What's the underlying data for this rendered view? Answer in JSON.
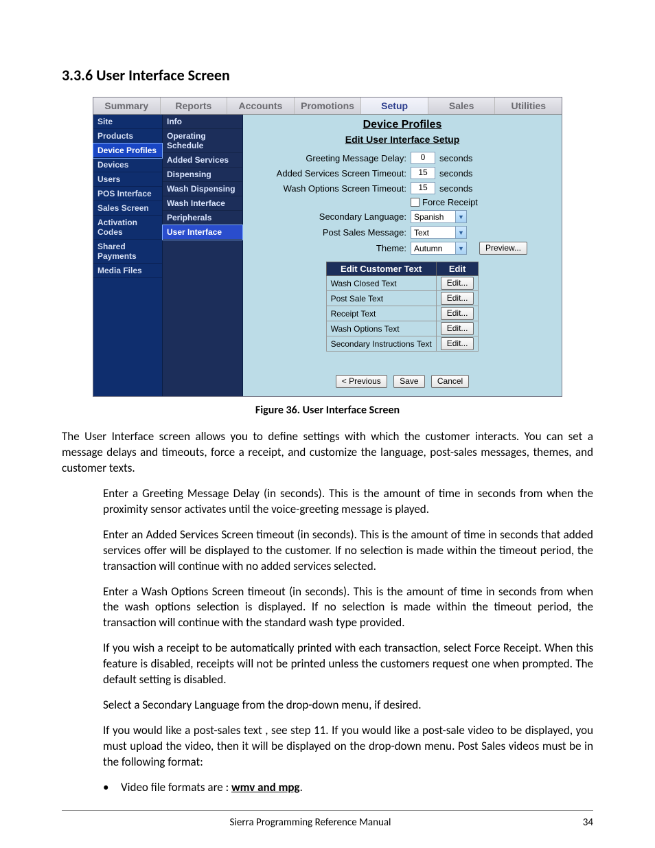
{
  "heading": "3.3.6  User Interface Screen",
  "caption": "Figure 36. User Interface Screen",
  "tabs": [
    "Summary",
    "Reports",
    "Accounts",
    "Promotions",
    "Setup",
    "Sales",
    "Utilities"
  ],
  "active_tab": "Setup",
  "nav": [
    "Site",
    "Products",
    "Device Profiles",
    "Devices",
    "Users",
    "POS Interface",
    "Sales Screen",
    "Activation Codes",
    "Shared Payments",
    "Media Files"
  ],
  "active_nav": "Device Profiles",
  "subnav": [
    "Info",
    "Operating Schedule",
    "Added Services",
    "Dispensing",
    "Wash Dispensing",
    "Wash Interface",
    "Peripherals",
    "User Interface"
  ],
  "active_subnav": "User Interface",
  "main_title": "Device Profiles",
  "main_sub": "Edit User Interface Setup",
  "form": {
    "greeting_label": "Greeting Message Delay:",
    "greeting_value": "0",
    "added_label": "Added Services Screen Timeout:",
    "added_value": "15",
    "wash_label": "Wash Options Screen Timeout:",
    "wash_value": "15",
    "seconds": "seconds",
    "force_receipt": "Force Receipt",
    "secondary_lang_label": "Secondary Language:",
    "secondary_lang_value": "Spanish",
    "post_sales_label": "Post Sales Message:",
    "post_sales_value": "Text",
    "theme_label": "Theme:",
    "theme_value": "Autumn",
    "preview_btn": "Preview..."
  },
  "grid": {
    "h1": "Edit Customer Text",
    "h2": "Edit",
    "rows": [
      "Wash Closed Text",
      "Post Sale Text",
      "Receipt Text",
      "Wash Options Text",
      "Secondary Instructions Text"
    ],
    "edit_btn": "Edit..."
  },
  "buttons": {
    "prev": "< Previous",
    "save": "Save",
    "cancel": "Cancel"
  },
  "para1": "The User Interface screen allows you to define settings with which the customer interacts. You can set a message delays and timeouts, force a receipt, and customize the language, post-sales messages, themes, and customer texts.",
  "para2": "Enter a Greeting Message Delay (in seconds). This is the amount of time in seconds from when the proximity sensor activates until the voice-greeting message is played.",
  "para3": "Enter an Added Services Screen timeout (in seconds). This is the amount of time in seconds that added services offer will be displayed to the customer. If no selection is made within the timeout period, the transaction will continue with no added services selected.",
  "para4": "Enter a Wash Options Screen timeout (in seconds). This is the amount of time in seconds from when the wash options selection is displayed. If no selection is made within the timeout period, the transaction will continue with the standard wash type provided.",
  "para5": "If you wish a receipt to be automatically printed with each transaction, select Force Receipt. When this feature is disabled, receipts will not be printed unless the customers request one when prompted. The default setting is disabled.",
  "para6": "Select a Secondary Language from the drop-down menu, if desired.",
  "para7": "If you would like a post-sales text , see step 11. If you would like  a post-sale video to be displayed, you must upload the video, then it will be displayed on the drop-down menu. Post Sales videos must be in the following format:",
  "bullet_lead": "Video file formats are : ",
  "bullet_bold": "wmv and mpg",
  "footer_title": "Sierra Programming Reference Manual",
  "footer_page": "34"
}
